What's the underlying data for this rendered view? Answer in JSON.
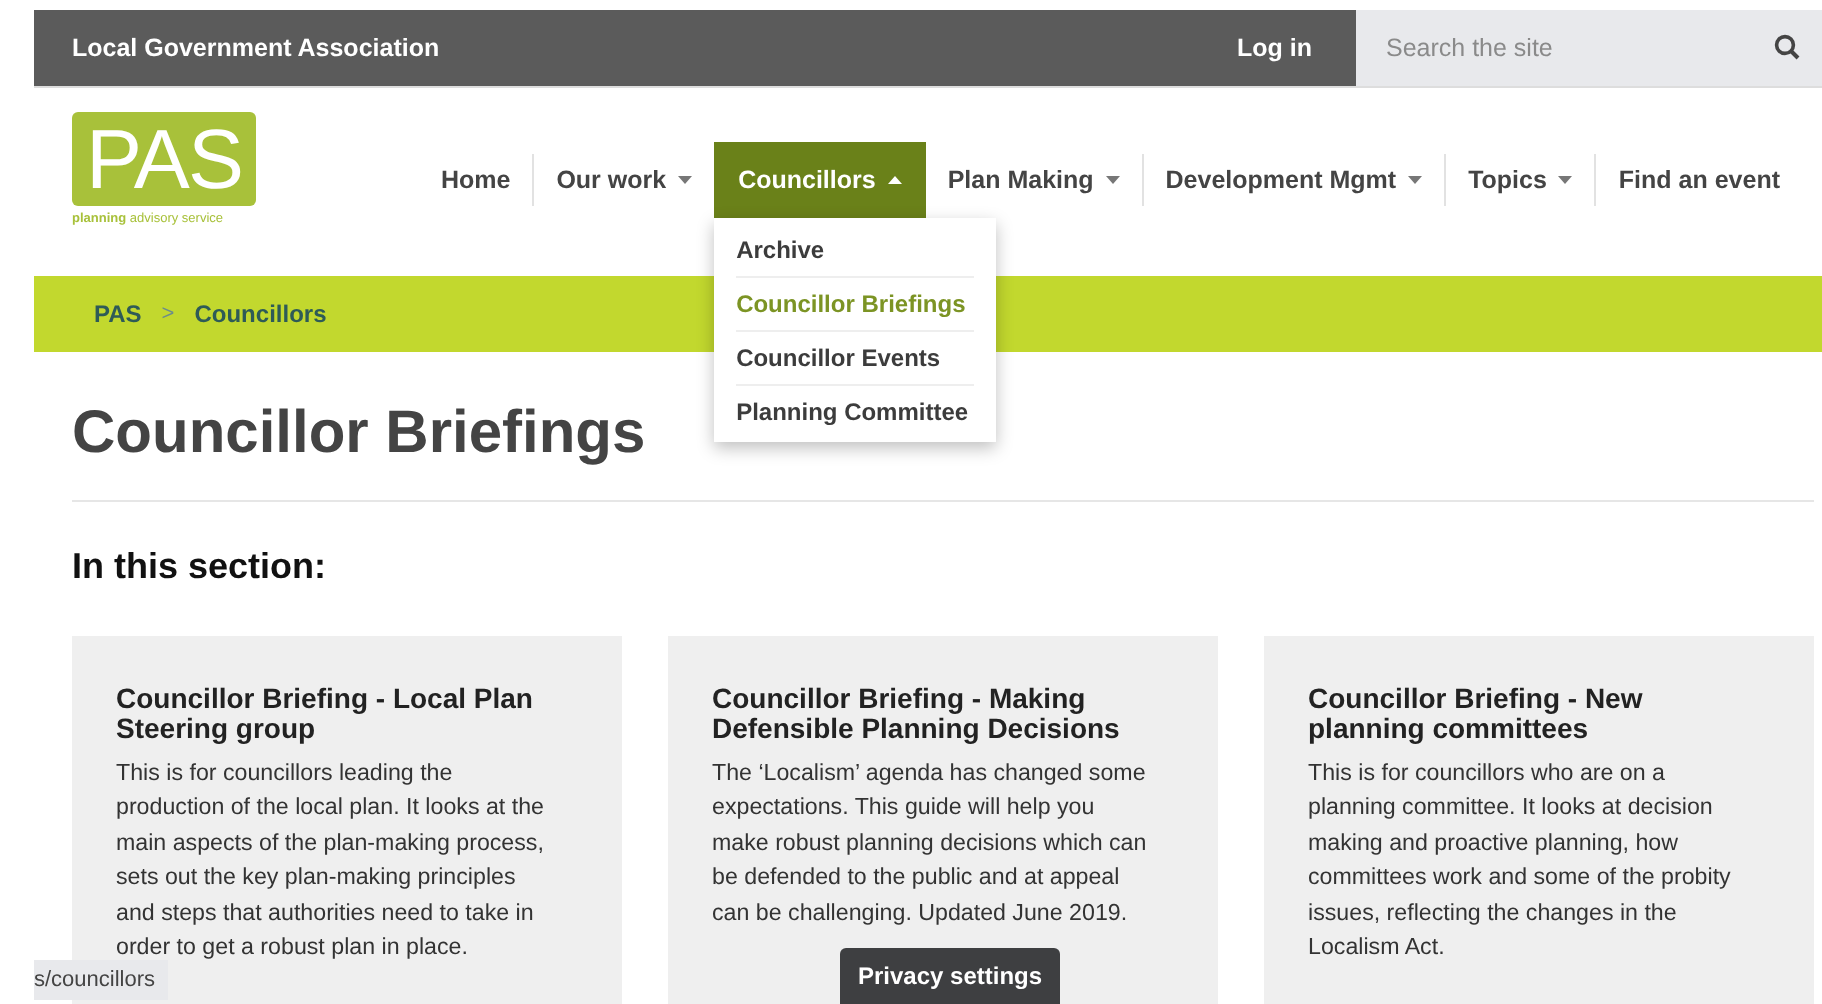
{
  "top_bar": {
    "organization": "Local Government Association",
    "login": "Log in",
    "search": {
      "placeholder": "Search the site"
    }
  },
  "logo": {
    "letters": "PAS",
    "tagline": "**planning** advisory service"
  },
  "nav": [
    {
      "label": "Home",
      "has_menu": false,
      "selected": false
    },
    {
      "label": "Our work",
      "has_menu": true,
      "selected": false
    },
    {
      "label": "Councillors",
      "has_menu": true,
      "selected": true
    },
    {
      "label": "Plan Making",
      "has_menu": true,
      "selected": false
    },
    {
      "label": "Development Mgmt",
      "has_menu": true,
      "selected": false
    },
    {
      "label": "Topics",
      "has_menu": true,
      "selected": false
    },
    {
      "label": "Find an event",
      "has_menu": false,
      "selected": false
    }
  ],
  "dropdown": [
    {
      "label": "Archive",
      "selected": false
    },
    {
      "label": "Councillor Briefings",
      "selected": true
    },
    {
      "label": "Councillor Events",
      "selected": false
    },
    {
      "label": "Planning Committee",
      "selected": false
    }
  ],
  "breadcrumb": [
    "PAS",
    "Councillors"
  ],
  "breadcrumb_separator": ">",
  "title": "Councillor Briefings",
  "section_heading": "In this section:",
  "cards": [
    {
      "title": "Councillor Briefing - Local Plan Steering group",
      "text": "This is for councillors leading the production of the local plan. It looks at the main aspects of the plan-making process, sets out the key plan-making principles and steps that authorities need to take in order to get a robust plan in place."
    },
    {
      "title": "Councillor Briefing - Making Defensible Planning Decisions",
      "text": "The ‘Localism’ agenda has changed some expectations. This guide will help you make robust planning decisions which can be defended to the public and at appeal can be challenging. Updated June 2019."
    },
    {
      "title": "Councillor Briefing - New planning committees",
      "text": "This is for councillors who are on a planning committee. It looks at decision making and proactive planning, how committees work and some of the probity issues, reflecting the changes in the Localism Act."
    }
  ],
  "status_url": "s/councillors",
  "privacy_button": "Privacy settings"
}
